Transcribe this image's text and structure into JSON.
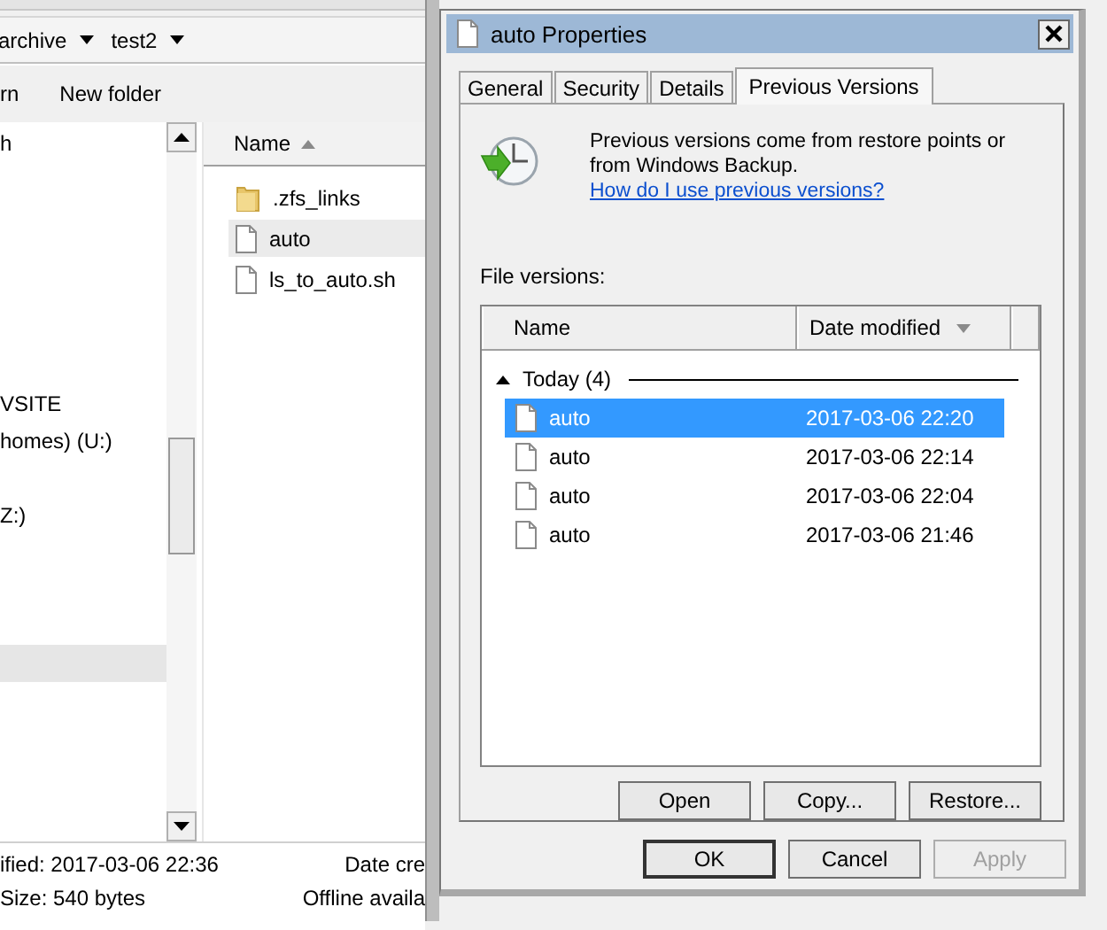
{
  "explorer": {
    "breadcrumbs": [
      {
        "label": "archive"
      },
      {
        "label": "test2"
      }
    ],
    "toolbar": [
      "rn",
      "New folder"
    ],
    "nav_items": [
      {
        "label": "h",
        "selected": false
      },
      {
        "selected": false
      },
      {
        "selected": false
      },
      {
        "selected": false
      },
      {
        "selected": false
      },
      {
        "selected": false
      },
      {
        "selected": false
      },
      {
        "label": "VSITE",
        "selected": false
      },
      {
        "label": "homes) (U:)",
        "selected": false
      },
      {
        "selected": false
      },
      {
        "label": "Z:)",
        "selected": false
      },
      {
        "selected": false
      },
      {
        "selected": false
      },
      {
        "selected": false
      },
      {
        "selected": true
      }
    ],
    "file_columns": [
      {
        "label": "Name",
        "sorted": true,
        "descending": false
      }
    ],
    "files": [
      {
        "name": ".zfs_links",
        "kind": "folder",
        "selected": false
      },
      {
        "name": "auto",
        "kind": "file",
        "selected": true
      },
      {
        "name": "ls_to_auto.sh",
        "kind": "file",
        "selected": false
      }
    ],
    "status_bar": {
      "left": [
        "ified: 2017-03-06 22:36",
        "Size: 540 bytes"
      ],
      "right": [
        "Date cre",
        "Offline availa"
      ]
    }
  },
  "dialog": {
    "title": "auto Properties",
    "tabs": [
      {
        "label": "General",
        "selected": false
      },
      {
        "label": "Security",
        "selected": false
      },
      {
        "label": "Details",
        "selected": false
      },
      {
        "label": "Previous Versions",
        "selected": true
      }
    ],
    "description": "Previous versions come from restore points or from Windows Backup.",
    "help_link": "How do I use previous versions?",
    "list_label": "File versions:",
    "columns": [
      {
        "label": "Name",
        "sorted": false
      },
      {
        "label": "Date modified",
        "sorted": true,
        "descending": true
      }
    ],
    "groups": [
      {
        "label": "Today (4)",
        "expanded": true,
        "rows": [
          {
            "name": "auto",
            "date": "2017-03-06 22:20",
            "selected": true
          },
          {
            "name": "auto",
            "date": "2017-03-06 22:14",
            "selected": false
          },
          {
            "name": "auto",
            "date": "2017-03-06 22:04",
            "selected": false
          },
          {
            "name": "auto",
            "date": "2017-03-06 21:46",
            "selected": false
          }
        ]
      }
    ],
    "actions": [
      {
        "label": "Open",
        "disabled": false
      },
      {
        "label": "Copy...",
        "disabled": false
      },
      {
        "label": "Restore...",
        "disabled": false
      }
    ],
    "buttons": [
      {
        "label": "OK",
        "default": true,
        "disabled": false
      },
      {
        "label": "Cancel",
        "default": false,
        "disabled": false
      },
      {
        "label": "Apply",
        "default": false,
        "disabled": true
      }
    ]
  }
}
